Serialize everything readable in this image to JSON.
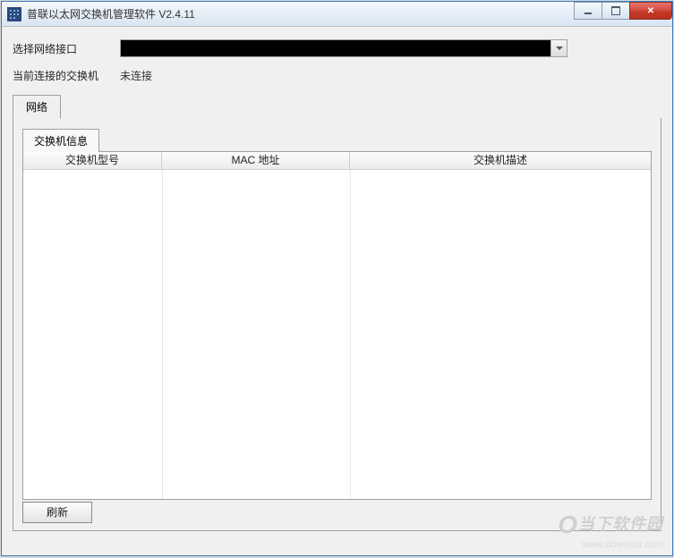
{
  "window": {
    "title": "普联以太网交换机管理软件 V2.4.11"
  },
  "form": {
    "interface_label": "选择网络接口",
    "interface_value": "",
    "connected_label": "当前连接的交换机",
    "connected_value": "未连接"
  },
  "tabs": {
    "network": "网络"
  },
  "panel": {
    "tab_label": "交换机信息",
    "columns": {
      "model": "交换机型号",
      "mac": "MAC 地址",
      "desc": "交换机描述"
    },
    "rows": []
  },
  "buttons": {
    "refresh": "刷新"
  },
  "watermark": {
    "brand": "当下软件园",
    "url": "www.downxia.com"
  }
}
